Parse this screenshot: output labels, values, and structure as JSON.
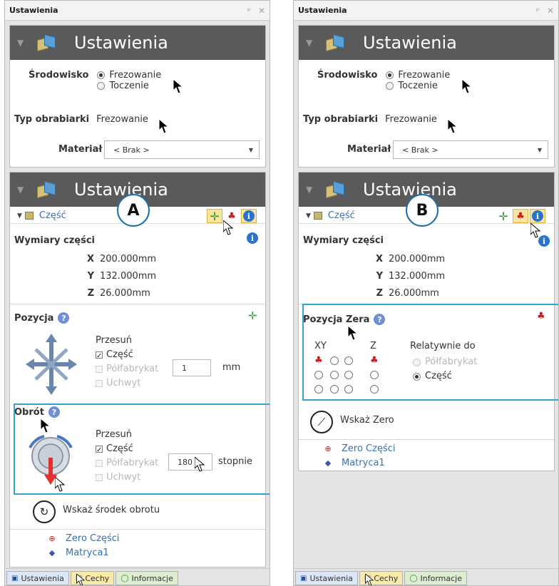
{
  "panel_a": {
    "title": "Ustawienia",
    "pin_icon": "pin-icon",
    "close_icon": "close-icon",
    "section1": {
      "header": "Ustawienia",
      "env_label": "Środowisko",
      "env_options": [
        "Frezowanie",
        "Toczenie"
      ],
      "env_selected": "Frezowanie",
      "machine_label": "Typ obrabiarki",
      "machine_value": "Frezowanie",
      "material_label": "Materiał",
      "material_value": "< Brak >"
    },
    "section2": {
      "header": "Ustawienia",
      "part_label": "Część",
      "callout": "A",
      "dims_label": "Wymiary części",
      "dims": [
        {
          "axis": "X",
          "value": "200.000mm"
        },
        {
          "axis": "Y",
          "value": "132.000mm"
        },
        {
          "axis": "Z",
          "value": "26.000mm"
        }
      ],
      "position_label": "Pozycja",
      "move_label": "Przesuń",
      "move_options": [
        {
          "label": "Część",
          "checked": true,
          "enabled": true
        },
        {
          "label": "Półfabrykat",
          "checked": false,
          "enabled": false
        },
        {
          "label": "Uchwyt",
          "checked": false,
          "enabled": false
        }
      ],
      "move_value": "1",
      "move_unit": "mm",
      "rotation_label": "Obrót",
      "rot_move_label": "Przesuń",
      "rot_options": [
        {
          "label": "Część",
          "checked": true,
          "enabled": true
        },
        {
          "label": "Półfabrykat",
          "checked": false,
          "enabled": false
        },
        {
          "label": "Uchwyt",
          "checked": false,
          "enabled": false
        }
      ],
      "rot_value": "180",
      "rot_unit": "stopnie",
      "pick_center": "Wskaż środek obrotu",
      "tree": [
        "Zero Części",
        "Matryca1"
      ]
    },
    "tabs": [
      "Ustawienia",
      "Cechy",
      "Informacje"
    ]
  },
  "panel_b": {
    "title": "Ustawienia",
    "section1": {
      "header": "Ustawienia",
      "env_label": "Środowisko",
      "env_options": [
        "Frezowanie",
        "Toczenie"
      ],
      "machine_label": "Typ obrabiarki",
      "machine_value": "Frezowanie",
      "material_label": "Materiał",
      "material_value": "< Brak >"
    },
    "section2": {
      "header": "Ustawienia",
      "part_label": "Część",
      "callout": "B",
      "dims_label": "Wymiary części",
      "dims": [
        {
          "axis": "X",
          "value": "200.000mm"
        },
        {
          "axis": "Y",
          "value": "132.000mm"
        },
        {
          "axis": "Z",
          "value": "26.000mm"
        }
      ],
      "zero_label": "Pozycja Zera",
      "xy_label": "XY",
      "z_label": "Z",
      "relative_label": "Relatywnie do",
      "relative_options": [
        {
          "label": "Półfabrykat",
          "selected": false,
          "enabled": false
        },
        {
          "label": "Część",
          "selected": true,
          "enabled": true
        }
      ],
      "pick_zero": "Wskaż Zero",
      "tree": [
        "Zero Części",
        "Matryca1"
      ]
    },
    "tabs": [
      "Ustawienia",
      "Cechy",
      "Informacje"
    ]
  },
  "colors": {
    "section_header": "#5a5a5a",
    "highlight": "#35a3cf",
    "link": "#3a6fb0",
    "selected_tool": "#fbe3a0"
  }
}
